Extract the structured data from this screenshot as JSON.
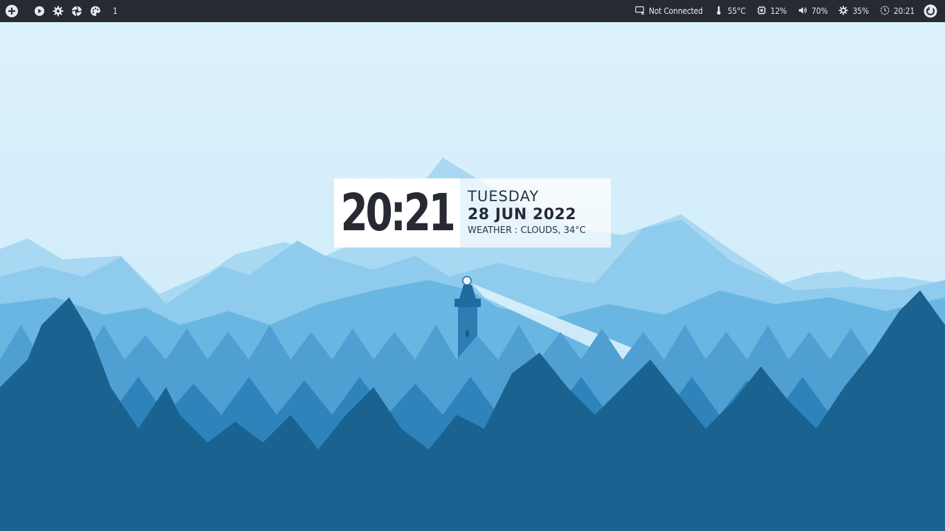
{
  "topbar": {
    "workspace": "1",
    "left_icons": [
      "plus-icon",
      "play-icon",
      "gear-icon",
      "aperture-icon",
      "palette-icon"
    ],
    "network": {
      "icon": "monitor-x-icon",
      "label": "Not Connected"
    },
    "temperature": {
      "icon": "thermometer-icon",
      "value": "55°C"
    },
    "cpu": {
      "icon": "cpu-icon",
      "value": "12%"
    },
    "volume": {
      "icon": "speaker-icon",
      "value": "70%"
    },
    "brightness": {
      "icon": "brightness-icon",
      "value": "35%"
    },
    "clock": {
      "icon": "clock-icon",
      "value": "20:21"
    },
    "power_icon": "power-icon"
  },
  "widget": {
    "time": "20:21",
    "day": "TUESDAY",
    "date": "28 JUN 2022",
    "weather": "WEATHER : CLOUDS, 34°C"
  },
  "colors": {
    "bar_bg": "#272a33",
    "bar_fg": "#e8e8e8",
    "sky": "#d9f0fc",
    "forest_dark": "#1a6391"
  }
}
